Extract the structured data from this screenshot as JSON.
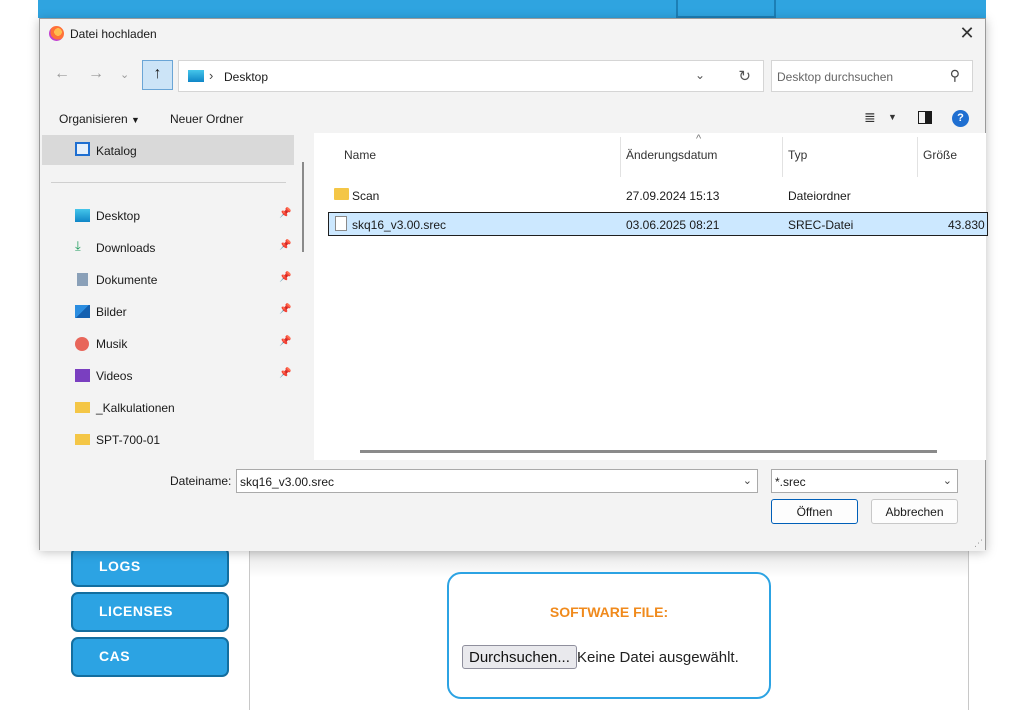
{
  "background_app": {
    "sidebar_buttons": [
      "LOGS",
      "LICENSES",
      "CAS"
    ],
    "upload": {
      "label": "SOFTWARE FILE:",
      "browse_button": "Durchsuchen...",
      "status": "Keine Datei ausgewählt."
    },
    "colors": {
      "accent": "#2ca3e3",
      "label": "#f08a1c"
    }
  },
  "dialog": {
    "title": "Datei hochladen",
    "address": {
      "location": "Desktop"
    },
    "search": {
      "placeholder": "Desktop durchsuchen"
    },
    "toolbar": {
      "organize": "Organisieren",
      "new_folder": "Neuer Ordner"
    },
    "nav": {
      "selected": "Katalog",
      "items": [
        {
          "label": "Desktop",
          "icon": "desktop-icon",
          "pinned": true
        },
        {
          "label": "Downloads",
          "icon": "download-icon",
          "pinned": true
        },
        {
          "label": "Dokumente",
          "icon": "document-icon",
          "pinned": true
        },
        {
          "label": "Bilder",
          "icon": "image-icon",
          "pinned": true
        },
        {
          "label": "Musik",
          "icon": "music-icon",
          "pinned": true
        },
        {
          "label": "Videos",
          "icon": "video-icon",
          "pinned": true
        },
        {
          "label": "_Kalkulationen",
          "icon": "folder-icon",
          "pinned": false
        },
        {
          "label": "SPT-700-01",
          "icon": "folder-icon",
          "pinned": false
        }
      ]
    },
    "columns": {
      "name": "Name",
      "date": "Änderungsdatum",
      "type": "Typ",
      "size": "Größe"
    },
    "files": [
      {
        "name": "Scan",
        "date": "27.09.2024 15:13",
        "type": "Dateiordner",
        "size": "",
        "kind": "folder"
      },
      {
        "name": "skq16_v3.00.srec",
        "date": "03.06.2025 08:21",
        "type": "SREC-Datei",
        "size": "43.830",
        "kind": "file"
      }
    ],
    "filename": {
      "label": "Dateiname:",
      "value": "skq16_v3.00.srec"
    },
    "filter": {
      "value": "*.srec"
    },
    "buttons": {
      "open": "Öffnen",
      "cancel": "Abbrechen"
    }
  }
}
